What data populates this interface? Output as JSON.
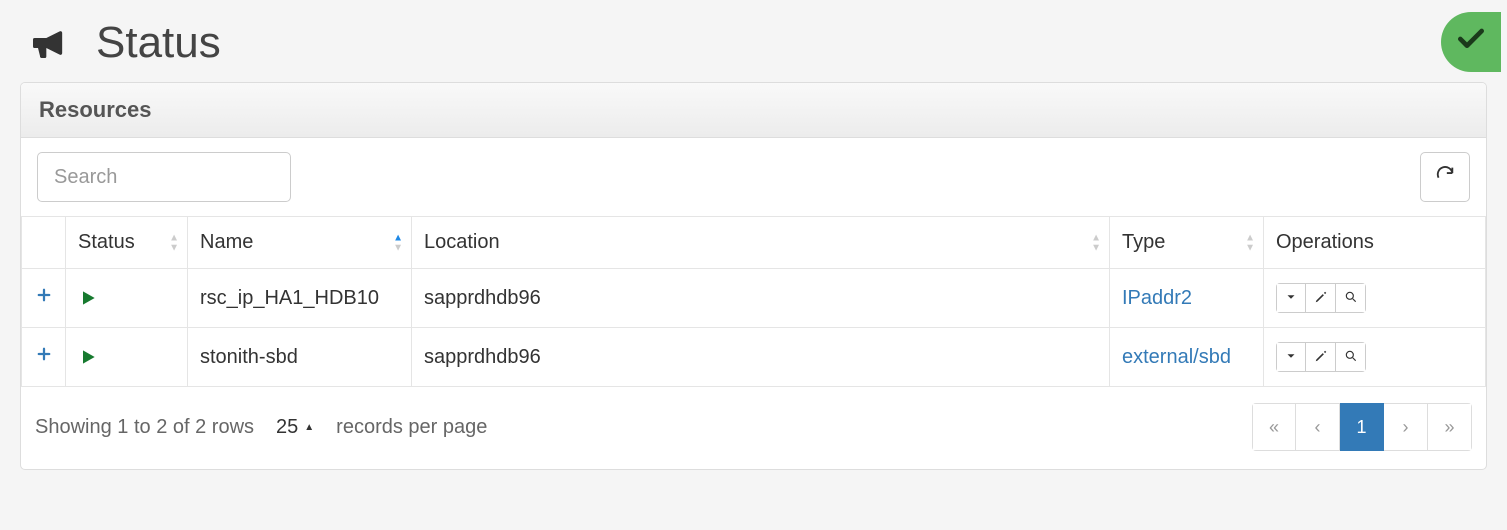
{
  "header": {
    "title": "Status"
  },
  "panel": {
    "title": "Resources"
  },
  "toolbar": {
    "search_placeholder": "Search"
  },
  "table": {
    "columns": {
      "status": "Status",
      "name": "Name",
      "location": "Location",
      "type": "Type",
      "operations": "Operations"
    },
    "rows": [
      {
        "name": "rsc_ip_HA1_HDB10",
        "location": "sapprdhdb96",
        "type": "IPaddr2"
      },
      {
        "name": "stonith-sbd",
        "location": "sapprdhdb96",
        "type": "external/sbd"
      }
    ]
  },
  "footer": {
    "summary": "Showing 1 to 2 of 2 rows",
    "page_size": "25",
    "records_label": "records per page"
  },
  "pagination": {
    "first": "«",
    "prev": "‹",
    "current": "1",
    "next": "›",
    "last": "»"
  }
}
